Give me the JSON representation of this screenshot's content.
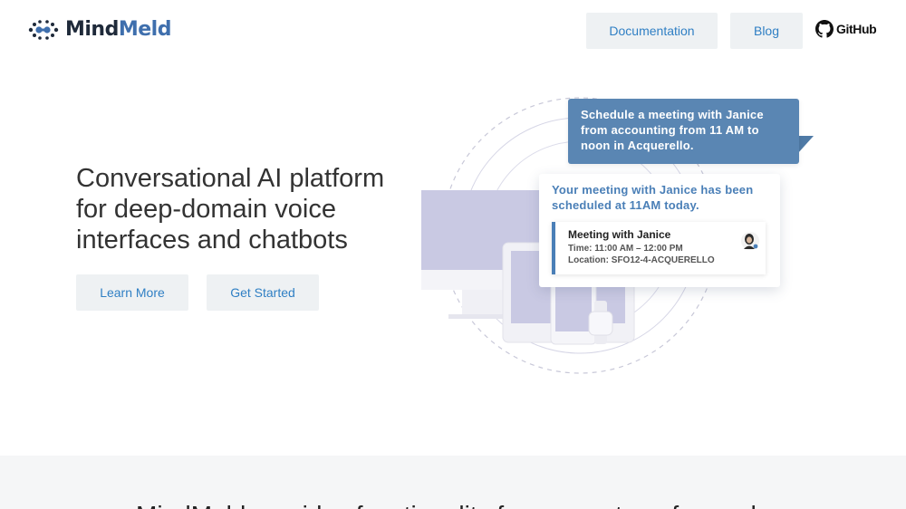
{
  "header": {
    "logo": {
      "mind": "Mind",
      "meld": "Meld",
      "icon": "mindmeld-dots-icon"
    },
    "nav": {
      "documentation": "Documentation",
      "blog": "Blog",
      "github": "GitHub",
      "github_icon": "github-octocat-icon"
    }
  },
  "hero": {
    "headline": "Conversational AI platform for deep-domain voice interfaces and chatbots",
    "buttons": {
      "learn_more": "Learn More",
      "get_started": "Get Started"
    }
  },
  "illustration": {
    "user_message": "Schedule a meeting with Janice from accounting from 11 AM to noon in Acquerello.",
    "bot_message": "Your meeting with Janice has been scheduled at 11AM today.",
    "meeting": {
      "title": "Meeting with Janice",
      "time": "Time: 11:00 AM – 12:00 PM",
      "location": "Location: SFO12-4-ACQUERELLO"
    },
    "colors": {
      "user_bubble": "#5a86b3",
      "bot_text": "#4a7fb7",
      "device": "#c9c9e3"
    }
  },
  "band": {
    "text": "MindMeld provides functionality for every step of a modern"
  },
  "colors": {
    "accent": "#2f7fc4",
    "button_bg": "#eef1f3",
    "band_bg": "#f5f6f7"
  }
}
